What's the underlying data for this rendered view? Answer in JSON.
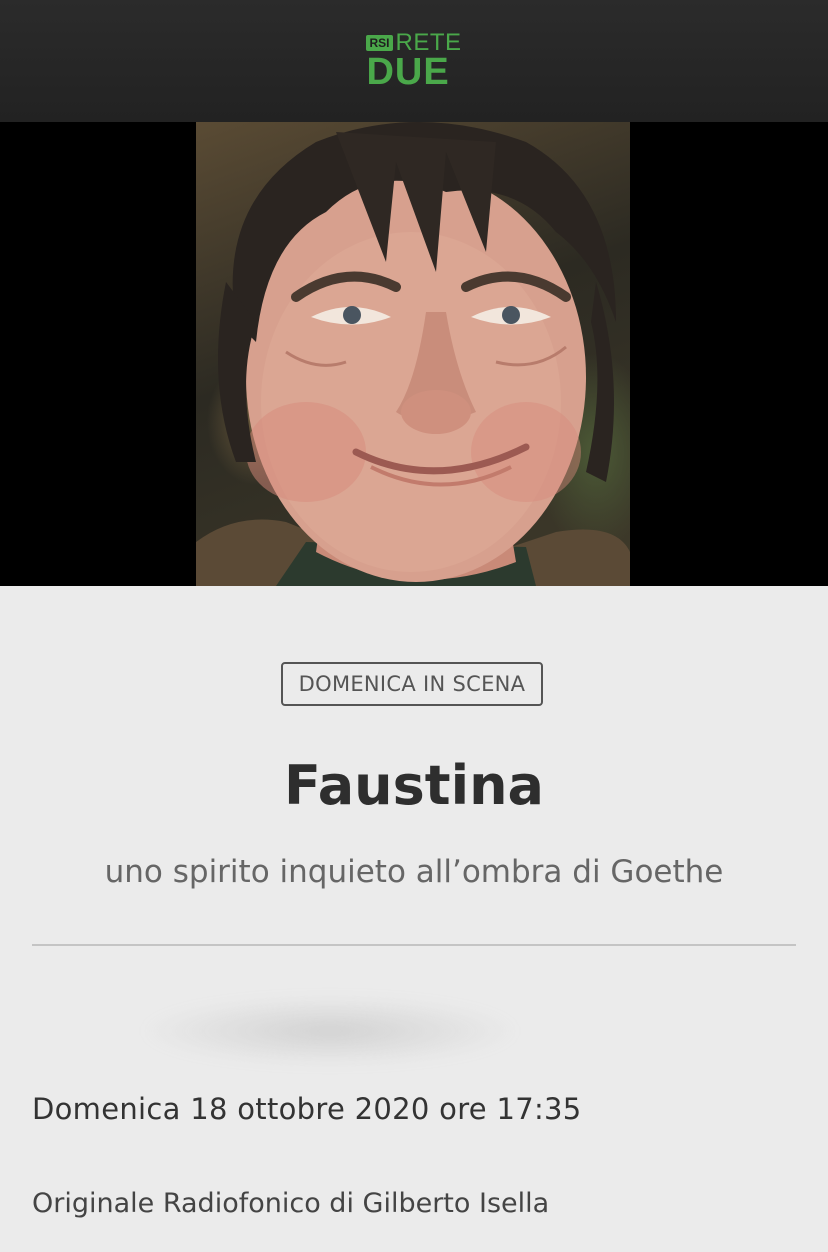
{
  "header": {
    "logo": {
      "badge": "RSI",
      "line1": "RETE",
      "line2": "DUE"
    },
    "brand_color": "#4aa84a"
  },
  "hero": {
    "image_description": "portrait-photo"
  },
  "program": {
    "category": "DOMENICA IN SCENA",
    "title": "Faustina",
    "subtitle": "uno spirito inquieto all’ombra di Goethe",
    "datetime": "Domenica 18 ottobre 2020 ore 17:35",
    "credits": "Originale Radiofonico di Gilberto Isella"
  }
}
